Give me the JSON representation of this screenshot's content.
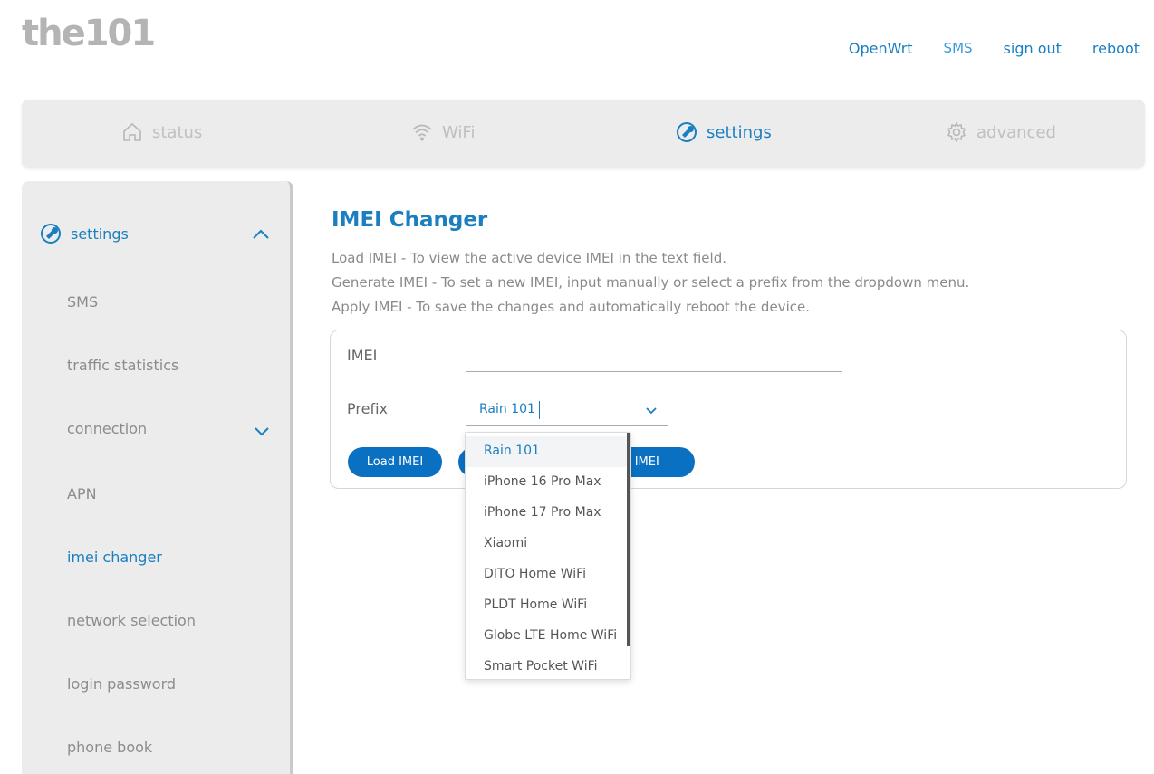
{
  "logo": "the101",
  "top_links": [
    "OpenWrt",
    "SMS",
    "sign out",
    "reboot"
  ],
  "main_nav": [
    {
      "label": "status",
      "icon": "home-icon",
      "active": false
    },
    {
      "label": "WiFi",
      "icon": "wifi-icon",
      "active": false
    },
    {
      "label": "settings",
      "icon": "wrench-icon",
      "active": true
    },
    {
      "label": "advanced",
      "icon": "gear-icon",
      "active": false
    }
  ],
  "sidebar": {
    "header": "settings",
    "items": [
      "SMS",
      "traffic statistics",
      "connection",
      "APN",
      "imei changer",
      "network selection",
      "login password",
      "phone book"
    ],
    "active": "imei changer"
  },
  "content": {
    "title": "IMEI Changer",
    "desc": [
      "Load IMEI - To view the active device IMEI in the text field.",
      "Generate IMEI - To set a new IMEI, input manually or select a prefix from the dropdown menu.",
      "Apply IMEI - To save the changes and automatically reboot the device."
    ],
    "imei_label": "IMEI",
    "imei_value": "",
    "prefix_label": "Prefix",
    "prefix_value": "Rain 101",
    "buttons": {
      "load": "Load IMEI",
      "generate": "",
      "apply": "ply IMEI"
    }
  },
  "dropdown": {
    "options": [
      "Rain 101",
      "iPhone 16 Pro Max",
      "iPhone 17 Pro Max",
      "Xiaomi",
      "DITO Home WiFi",
      "PLDT Home WiFi",
      "Globe LTE Home WiFi",
      "Smart Pocket WiFi"
    ],
    "selected": "Rain 101"
  },
  "colors": {
    "accent": "#1a7fc1",
    "button": "#0a70c2",
    "muted": "#c0c0c0"
  }
}
